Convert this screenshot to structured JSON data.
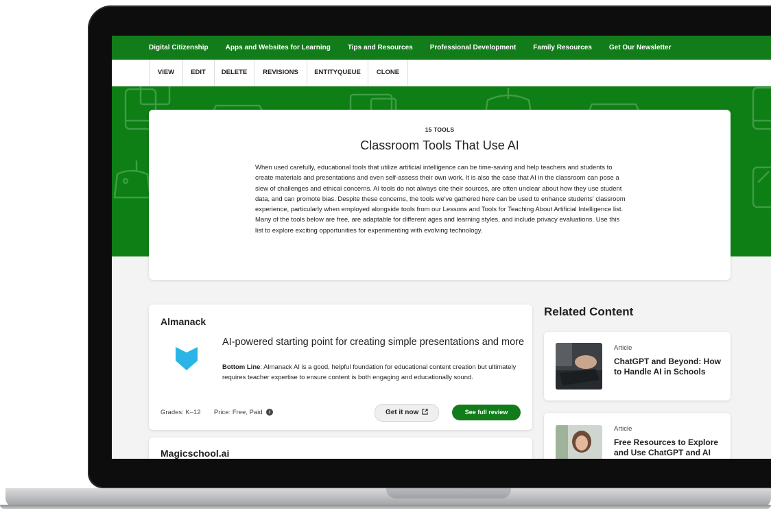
{
  "nav": {
    "items": [
      "Digital Citizenship",
      "Apps and Websites for Learning",
      "Tips and Resources",
      "Professional Development",
      "Family Resources",
      "Get Our Newsletter"
    ]
  },
  "admin_tabs": [
    "VIEW",
    "EDIT",
    "DELETE",
    "REVISIONS",
    "ENTITYQUEUE",
    "CLONE"
  ],
  "hero": {
    "kicker": "15 TOOLS",
    "title": "Classroom Tools That Use AI",
    "body": "When used carefully, educational tools that utilize artificial intelligence can be time-saving and help teachers and students to create materials and presentations and even self-assess their own work. It is also the case that AI in the classroom can pose a slew of challenges and ethical concerns. AI tools do not always cite their sources, are often unclear about how they use student data, and can promote bias. Despite these concerns, the tools we've gathered here can be used to enhance students' classroom experience, particularly when employed alongside tools from our Lessons and Tools for Teaching About Artificial Intelligence list. Many of the tools below are free, are adaptable for different ages and learning styles, and include privacy evaluations. Use this list to explore exciting opportunities for experimenting with evolving technology."
  },
  "tools": [
    {
      "name": "Almanack",
      "tagline": "AI-powered starting point for creating simple presentations and more",
      "bottom_line_label": "Bottom Line",
      "bottom_line_text": ": Almanack AI is a good, helpful foundation for educational content creation but ultimately requires teacher expertise to ensure content is both engaging and educationally sound.",
      "grades": "Grades: K–12",
      "price": "Price: Free, Paid",
      "get_it_label": "Get it now",
      "review_label": "See full review",
      "logo_color": "#2bb5e6"
    },
    {
      "name": "Magicschool.ai"
    }
  ],
  "related": {
    "heading": "Related Content",
    "items": [
      {
        "kind": "Article",
        "title": "ChatGPT and Beyond: How to Handle AI in Schools"
      },
      {
        "kind": "Article",
        "title": "Free Resources to Explore and Use ChatGPT and AI"
      }
    ]
  },
  "colors": {
    "brand_green": "#127c1a",
    "hero_green": "#0d7f15",
    "pattern_green": "#3a9a3f"
  },
  "icons": {
    "info": "i",
    "external_link": "external-link-icon"
  }
}
